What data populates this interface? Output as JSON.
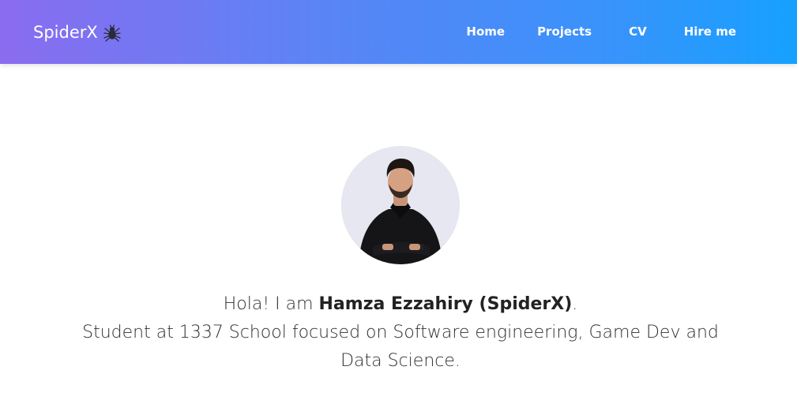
{
  "navbar": {
    "brand": "SpiderX",
    "brand_icon": "spider-icon",
    "gradient": [
      "#8a6cf0",
      "#16a1ff"
    ],
    "links": [
      {
        "label": "Home"
      },
      {
        "label": "Projects"
      },
      {
        "label": "CV"
      },
      {
        "label": "Hire me"
      }
    ]
  },
  "hero": {
    "avatar_icon": "profile-photo",
    "greeting_prefix": "Hola! I am ",
    "name": "Hamza Ezzahiry (SpiderX)",
    "greeting_suffix": ".",
    "description": "Student at 1337 School focused on Software engineering, Game Dev and Data Science."
  }
}
